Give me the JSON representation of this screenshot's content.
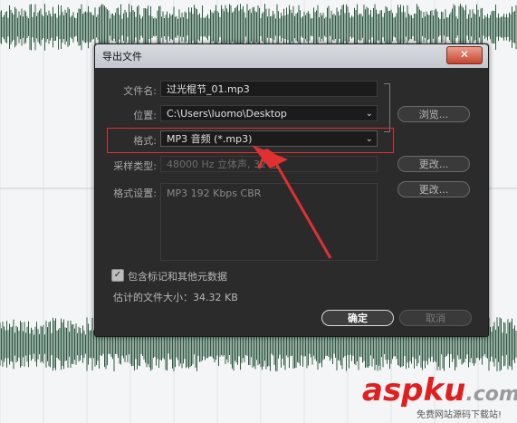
{
  "dialog": {
    "title": "导出文件",
    "close_glyph": "✕",
    "filename_label": "文件名:",
    "filename_value": "过光棍节_01.mp3",
    "location_label": "位置:",
    "location_value": "C:\\Users\\luomo\\Desktop",
    "browse_label": "浏览...",
    "format_label": "格式:",
    "format_value": "MP3 音频 (*.mp3)",
    "sample_type_label": "采样类型:",
    "sample_type_value": "48000 Hz 立体声, 32 位",
    "change_label": "更改...",
    "format_settings_label": "格式设置:",
    "format_settings_value": "MP3 192 Kbps CBR",
    "include_markers_label": "包含标记和其他元数据",
    "include_markers_checked": true,
    "estimated_size_label": "估计的文件大小：34.32 KB",
    "ok_label": "确定",
    "cancel_label": "取消"
  },
  "watermark": {
    "brand_red": "aspku",
    "brand_gray": ".com",
    "tagline": "免费网站源码下载站!"
  },
  "colors": {
    "waveform": "#2f5a44",
    "highlight": "#e03030",
    "arrow": "#e03030"
  }
}
